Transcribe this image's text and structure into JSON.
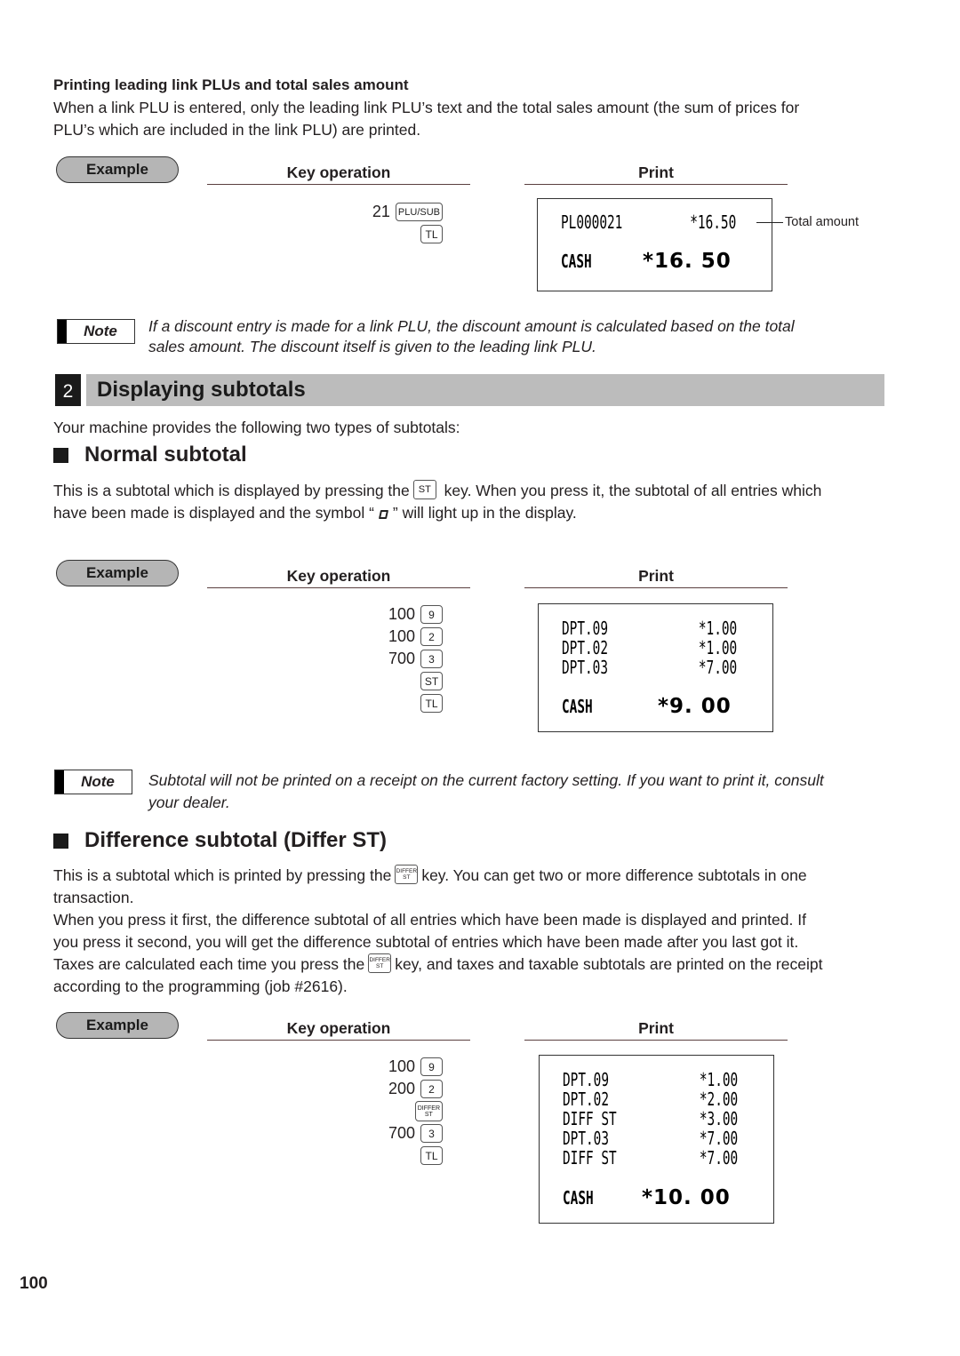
{
  "page_number": "100",
  "link_plu": {
    "heading": "Printing leading link PLUs and total sales amount",
    "body_line1": "When a link PLU is entered, only the leading link PLU’s text and the total sales amount (the sum of prices for",
    "body_line2": "PLU’s which are included in the link PLU) are printed.",
    "example_label": "Example",
    "key_operation_label": "Key operation",
    "print_label": "Print",
    "key_ops": [
      {
        "num": "21",
        "key": "PLU/SUB"
      },
      {
        "num": "",
        "key": "TL"
      }
    ],
    "receipt": {
      "lines": [
        {
          "left": "PL000021",
          "right": "*16.50"
        }
      ],
      "total": {
        "left": "CASH",
        "right": "*16. 50"
      }
    },
    "callout": "Total amount",
    "note_label": "Note",
    "note_line1": "If a discount entry is made for a link PLU, the discount amount is calculated based on the total",
    "note_line2": "sales amount. The discount itself is given to the leading link PLU."
  },
  "section": {
    "number": "2",
    "title": "Displaying subtotals",
    "intro": "Your machine provides the following two types of subtotals:"
  },
  "normal_subtotal": {
    "heading": "Normal subtotal",
    "body_part1": "This is a subtotal which is displayed by pressing the",
    "key": "ST",
    "body_part2": "key. When you press it, the subtotal of all entries which",
    "body_line2_part1": "have been made is displayed and the symbol “",
    "body_line2_part2": "” will light up in the display.",
    "example_label": "Example",
    "key_operation_label": "Key operation",
    "print_label": "Print",
    "key_ops": [
      {
        "num": "100",
        "key": "9"
      },
      {
        "num": "100",
        "key": "2"
      },
      {
        "num": "700",
        "key": "3"
      },
      {
        "num": "",
        "key": "ST"
      },
      {
        "num": "",
        "key": "TL"
      }
    ],
    "receipt": {
      "lines": [
        {
          "left": "DPT.09",
          "right": "*1.00"
        },
        {
          "left": "DPT.02",
          "right": "*1.00"
        },
        {
          "left": "DPT.03",
          "right": "*7.00"
        }
      ],
      "total": {
        "left": "CASH",
        "right": "*9. 00"
      }
    },
    "note_label": "Note",
    "note_line1": "Subtotal will not be printed on a receipt on the current factory setting. If you want to print it, consult",
    "note_line2": "your dealer."
  },
  "difference_subtotal": {
    "heading": "Difference subtotal (Differ ST)",
    "p1_part1": "This is a subtotal which is printed by pressing the",
    "key_top": "DIFFER",
    "key_bottom": "ST",
    "p1_part2": "key. You can get two or more difference subtotals in one",
    "p1_line2": "transaction.",
    "p2_line1": "When you press it first, the difference subtotal of all entries which have been made is displayed and printed. If",
    "p2_line2": "you press it second, you will get the difference subtotal of entries which have been made after you last got it.",
    "p3_part1": "Taxes are calculated each time you press the",
    "p3_part2": "key, and taxes and taxable subtotals are printed on the receipt",
    "p3_line2": "according to the programming (job #2616).",
    "example_label": "Example",
    "key_operation_label": "Key operation",
    "print_label": "Print",
    "key_ops": [
      {
        "num": "100",
        "key": "9"
      },
      {
        "num": "200",
        "key": "2"
      },
      {
        "num": "",
        "key": "DIFFER ST"
      },
      {
        "num": "700",
        "key": "3"
      },
      {
        "num": "",
        "key": "TL"
      }
    ],
    "receipt": {
      "lines": [
        {
          "left": "DPT.09",
          "right": "*1.00"
        },
        {
          "left": "DPT.02",
          "right": "*2.00"
        },
        {
          "left": "DIFF ST",
          "right": "*3.00"
        },
        {
          "left": "DPT.03",
          "right": "*7.00"
        },
        {
          "left": "DIFF ST",
          "right": "*7.00"
        }
      ],
      "total": {
        "left": "CASH",
        "right": "*10. 00"
      }
    }
  }
}
